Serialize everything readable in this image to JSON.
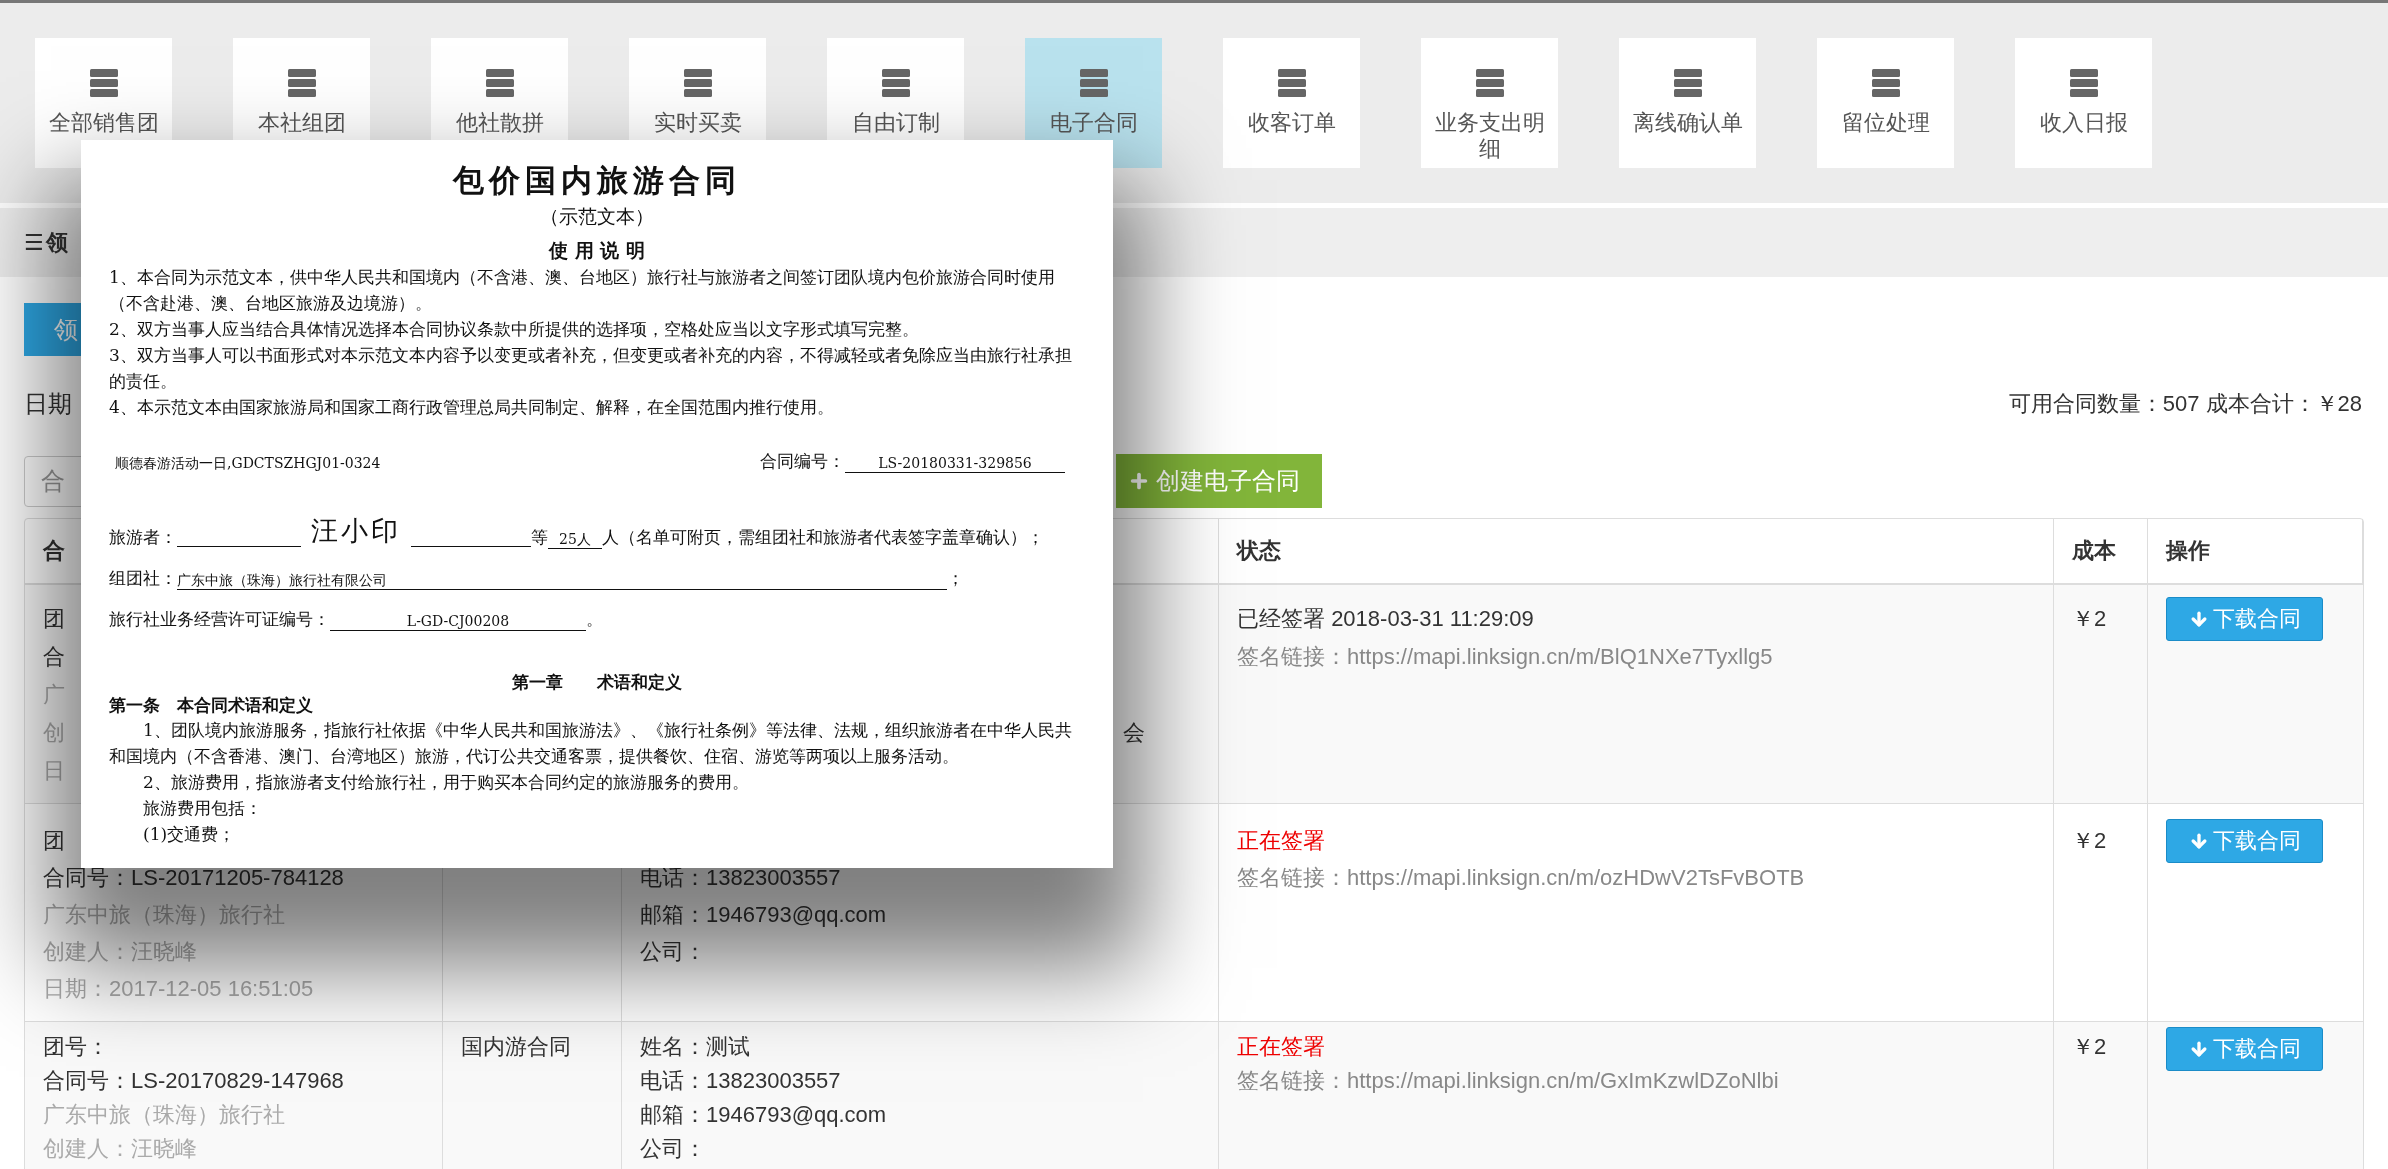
{
  "nav": [
    {
      "label": "全部销售团",
      "selected": false
    },
    {
      "label": "本社组团",
      "selected": false
    },
    {
      "label": "他社散拼",
      "selected": false
    },
    {
      "label": "实时买卖",
      "selected": false
    },
    {
      "label": "自由订制",
      "selected": false
    },
    {
      "label": "电子合同",
      "selected": true
    },
    {
      "label": "收客订单",
      "selected": false
    },
    {
      "label": "业务支出明细",
      "selected": false
    },
    {
      "label": "离线确认单",
      "selected": false
    },
    {
      "label": "留位处理",
      "selected": false
    },
    {
      "label": "收入日报",
      "selected": false
    }
  ],
  "section": {
    "icon": "☰",
    "title": "领"
  },
  "primary_button": "领",
  "filter": {
    "date_label": "日期",
    "search_placeholder": "合",
    "create_button": "创建电子合同"
  },
  "summary": "可用合同数量：507 成本合计：￥28",
  "table": {
    "columns": {
      "column_1": "合",
      "status": "状态",
      "cost": "成本",
      "action": "操作"
    },
    "rows": [
      {
        "group_lines": [
          {
            "text": "团",
            "muted": false
          },
          {
            "text": "合",
            "muted": false
          },
          {
            "text": "广",
            "muted": true
          },
          {
            "text": "创",
            "muted": true
          },
          {
            "text": "日",
            "muted": true
          }
        ],
        "contact_lines": [
          "会"
        ],
        "status": {
          "kind": "signed",
          "text": "已经签署",
          "time": "2018-03-31 11:29:09"
        },
        "link": "签名链接：https://mapi.linksign.cn/m/BlQ1NXe7Tyxllg5",
        "cost": "￥2",
        "action": "下载合同"
      },
      {
        "group_lines": [
          {
            "text": "团",
            "muted": false
          },
          {
            "text": "合同号：LS-20171205-784128",
            "muted": false
          },
          {
            "text": "广东中旅（珠海）旅行社",
            "muted": true
          },
          {
            "text": "创建人：汪晓峰",
            "muted": true
          },
          {
            "text": "日期：2017-12-05 16:51:05",
            "muted": true
          }
        ],
        "contact_lines": [
          "电话：13823003557",
          "邮箱：1946793@qq.com",
          "公司："
        ],
        "status": {
          "kind": "signing",
          "text": "正在签署"
        },
        "link": "签名链接：https://mapi.linksign.cn/m/ozHDwV2TsFvBOTB",
        "cost": "￥2",
        "action": "下载合同"
      },
      {
        "group_lines": [
          {
            "text": "团号：",
            "muted": false
          },
          {
            "text": "合同号：LS-20170829-147968",
            "muted": false
          },
          {
            "text": "广东中旅（珠海）旅行社",
            "muted": true
          },
          {
            "text": "创建人：汪晓峰",
            "muted": true
          }
        ],
        "type": "国内游合同",
        "contact_lines": [
          "姓名：测试",
          "电话：13823003557",
          "邮箱：1946793@qq.com",
          "公司："
        ],
        "status": {
          "kind": "signing",
          "text": "正在签署"
        },
        "link": "签名链接：https://mapi.linksign.cn/m/GxImKzwlDZoNlbi",
        "cost": "￥2",
        "action": "下载合同"
      }
    ]
  },
  "document": {
    "title": "包价国内旅游合同",
    "subtitle": "（示范文本）",
    "notes_heading": "使 用 说 明",
    "notes": [
      "1、本合同为示范文本，供中华人民共和国境内（不含港、澳、台地区）旅行社与旅游者之间签订团队境内包价旅游合同时使用（不含赴港、澳、台地区旅游及边境游）。",
      "2、双方当事人应当结合具体情况选择本合同协议条款中所提供的选择项，空格处应当以文字形式填写完整。",
      "3、双方当事人可以书面形式对本示范文本内容予以变更或者补充，但变更或者补充的内容，不得减轻或者免除应当由旅行社承担的责任。",
      "4、本示范文本由国家旅游局和国家工商行政管理总局共同制定、解释，在全国范围内推行使用。"
    ],
    "activity": "顺德春游活动一日,GDCTSZHGJ01-0324",
    "contract_no_label": "合同编号：",
    "contract_no": "LS-20180331-329856",
    "traveler_label": "旅游者：",
    "traveler_name": "汪小印",
    "count_prefix": "等",
    "count": "25人",
    "count_suffix": "人（名单可附页，需组团社和旅游者代表签字盖章确认）；",
    "organizer_label": "组团社：",
    "organizer": "广东中旅（珠海）旅行社有限公司",
    "organizer_end": "；",
    "license_label": "旅行社业务经营许可证编号：",
    "license": "L-GD-CJ00208",
    "license_end": "。",
    "chapter": "第一章　　术语和定义",
    "article": "第一条　本合同术语和定义",
    "clauses": [
      "1、团队境内旅游服务，指旅行社依据《中华人民共和国旅游法》、《旅行社条例》等法律、法规，组织旅游者在中华人民共和国境内（不含香港、澳门、台湾地区）旅游，代订公共交通客票，提供餐饮、住宿、游览等两项以上服务活动。",
      "2、旅游费用，指旅游者支付给旅行社，用于购买本合同约定的旅游服务的费用。",
      "旅游费用包括：",
      "(1)交通费；"
    ]
  }
}
